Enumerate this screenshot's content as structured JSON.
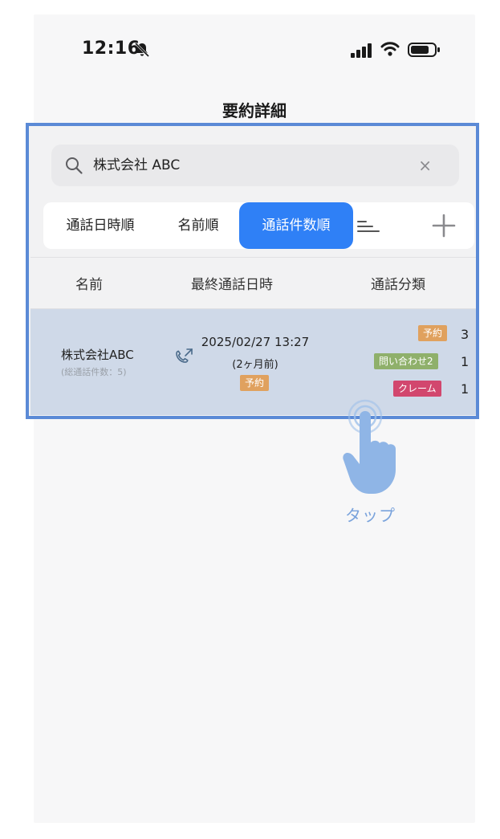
{
  "status_bar": {
    "time": "12:16"
  },
  "nav": {
    "title": "要約詳細"
  },
  "search": {
    "value": "株式会社 ABC",
    "clear": "×"
  },
  "sort_tabs": [
    {
      "label": "通話日時順",
      "active": false
    },
    {
      "label": "名前順",
      "active": false
    },
    {
      "label": "通話件数順",
      "active": true
    }
  ],
  "columns": [
    "名前",
    "最終通話日時",
    "通話分類"
  ],
  "rows": [
    {
      "name": "株式会社ABC",
      "sub": "(総通話件数：5)",
      "date": "2025/02/27 13:27",
      "ago": "(2ヶ月前)",
      "last_tag": "予約",
      "categories": [
        {
          "label": "予約",
          "count": "3",
          "color": "#e0a15e"
        },
        {
          "label": "問い合わせ2",
          "count": "1",
          "color": "#8fb06b"
        },
        {
          "label": "クレーム",
          "count": "1",
          "color": "#d2476e"
        }
      ]
    }
  ],
  "tap_hint": "タップ",
  "colors": {
    "accent": "#2f80f6",
    "highlight_border": "#5b8ad6",
    "row_selected": "#cfd9e8"
  }
}
